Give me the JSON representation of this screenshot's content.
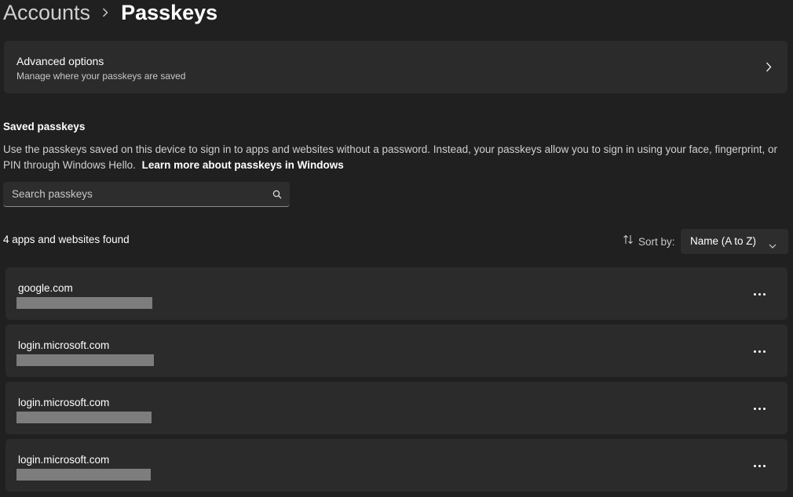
{
  "breadcrumb": {
    "parent": "Accounts",
    "current": "Passkeys"
  },
  "advanced_options": {
    "title": "Advanced options",
    "subtitle": "Manage where your passkeys are saved",
    "icon": "chevron-right-icon"
  },
  "saved_passkeys": {
    "heading": "Saved passkeys",
    "description": "Use the passkeys saved on this device to sign in to apps and websites without a password. Instead, your passkeys allow you to sign in using your face, fingerprint, or PIN through Windows Hello.",
    "learn_more": "Learn more about passkeys in Windows"
  },
  "search": {
    "placeholder": "Search passkeys",
    "value": "",
    "icon": "search-icon"
  },
  "results": {
    "count_text": "4 apps and websites found"
  },
  "sort": {
    "icon": "sort-arrows-icon",
    "label": "Sort by:",
    "selected": "Name (A to Z)"
  },
  "passkeys": [
    {
      "site": "google.com"
    },
    {
      "site": "login.microsoft.com"
    },
    {
      "site": "login.microsoft.com"
    },
    {
      "site": "login.microsoft.com"
    }
  ],
  "colors": {
    "background": "#202020",
    "card": "#2b2b2b",
    "redaction": "#7d7d7d"
  }
}
